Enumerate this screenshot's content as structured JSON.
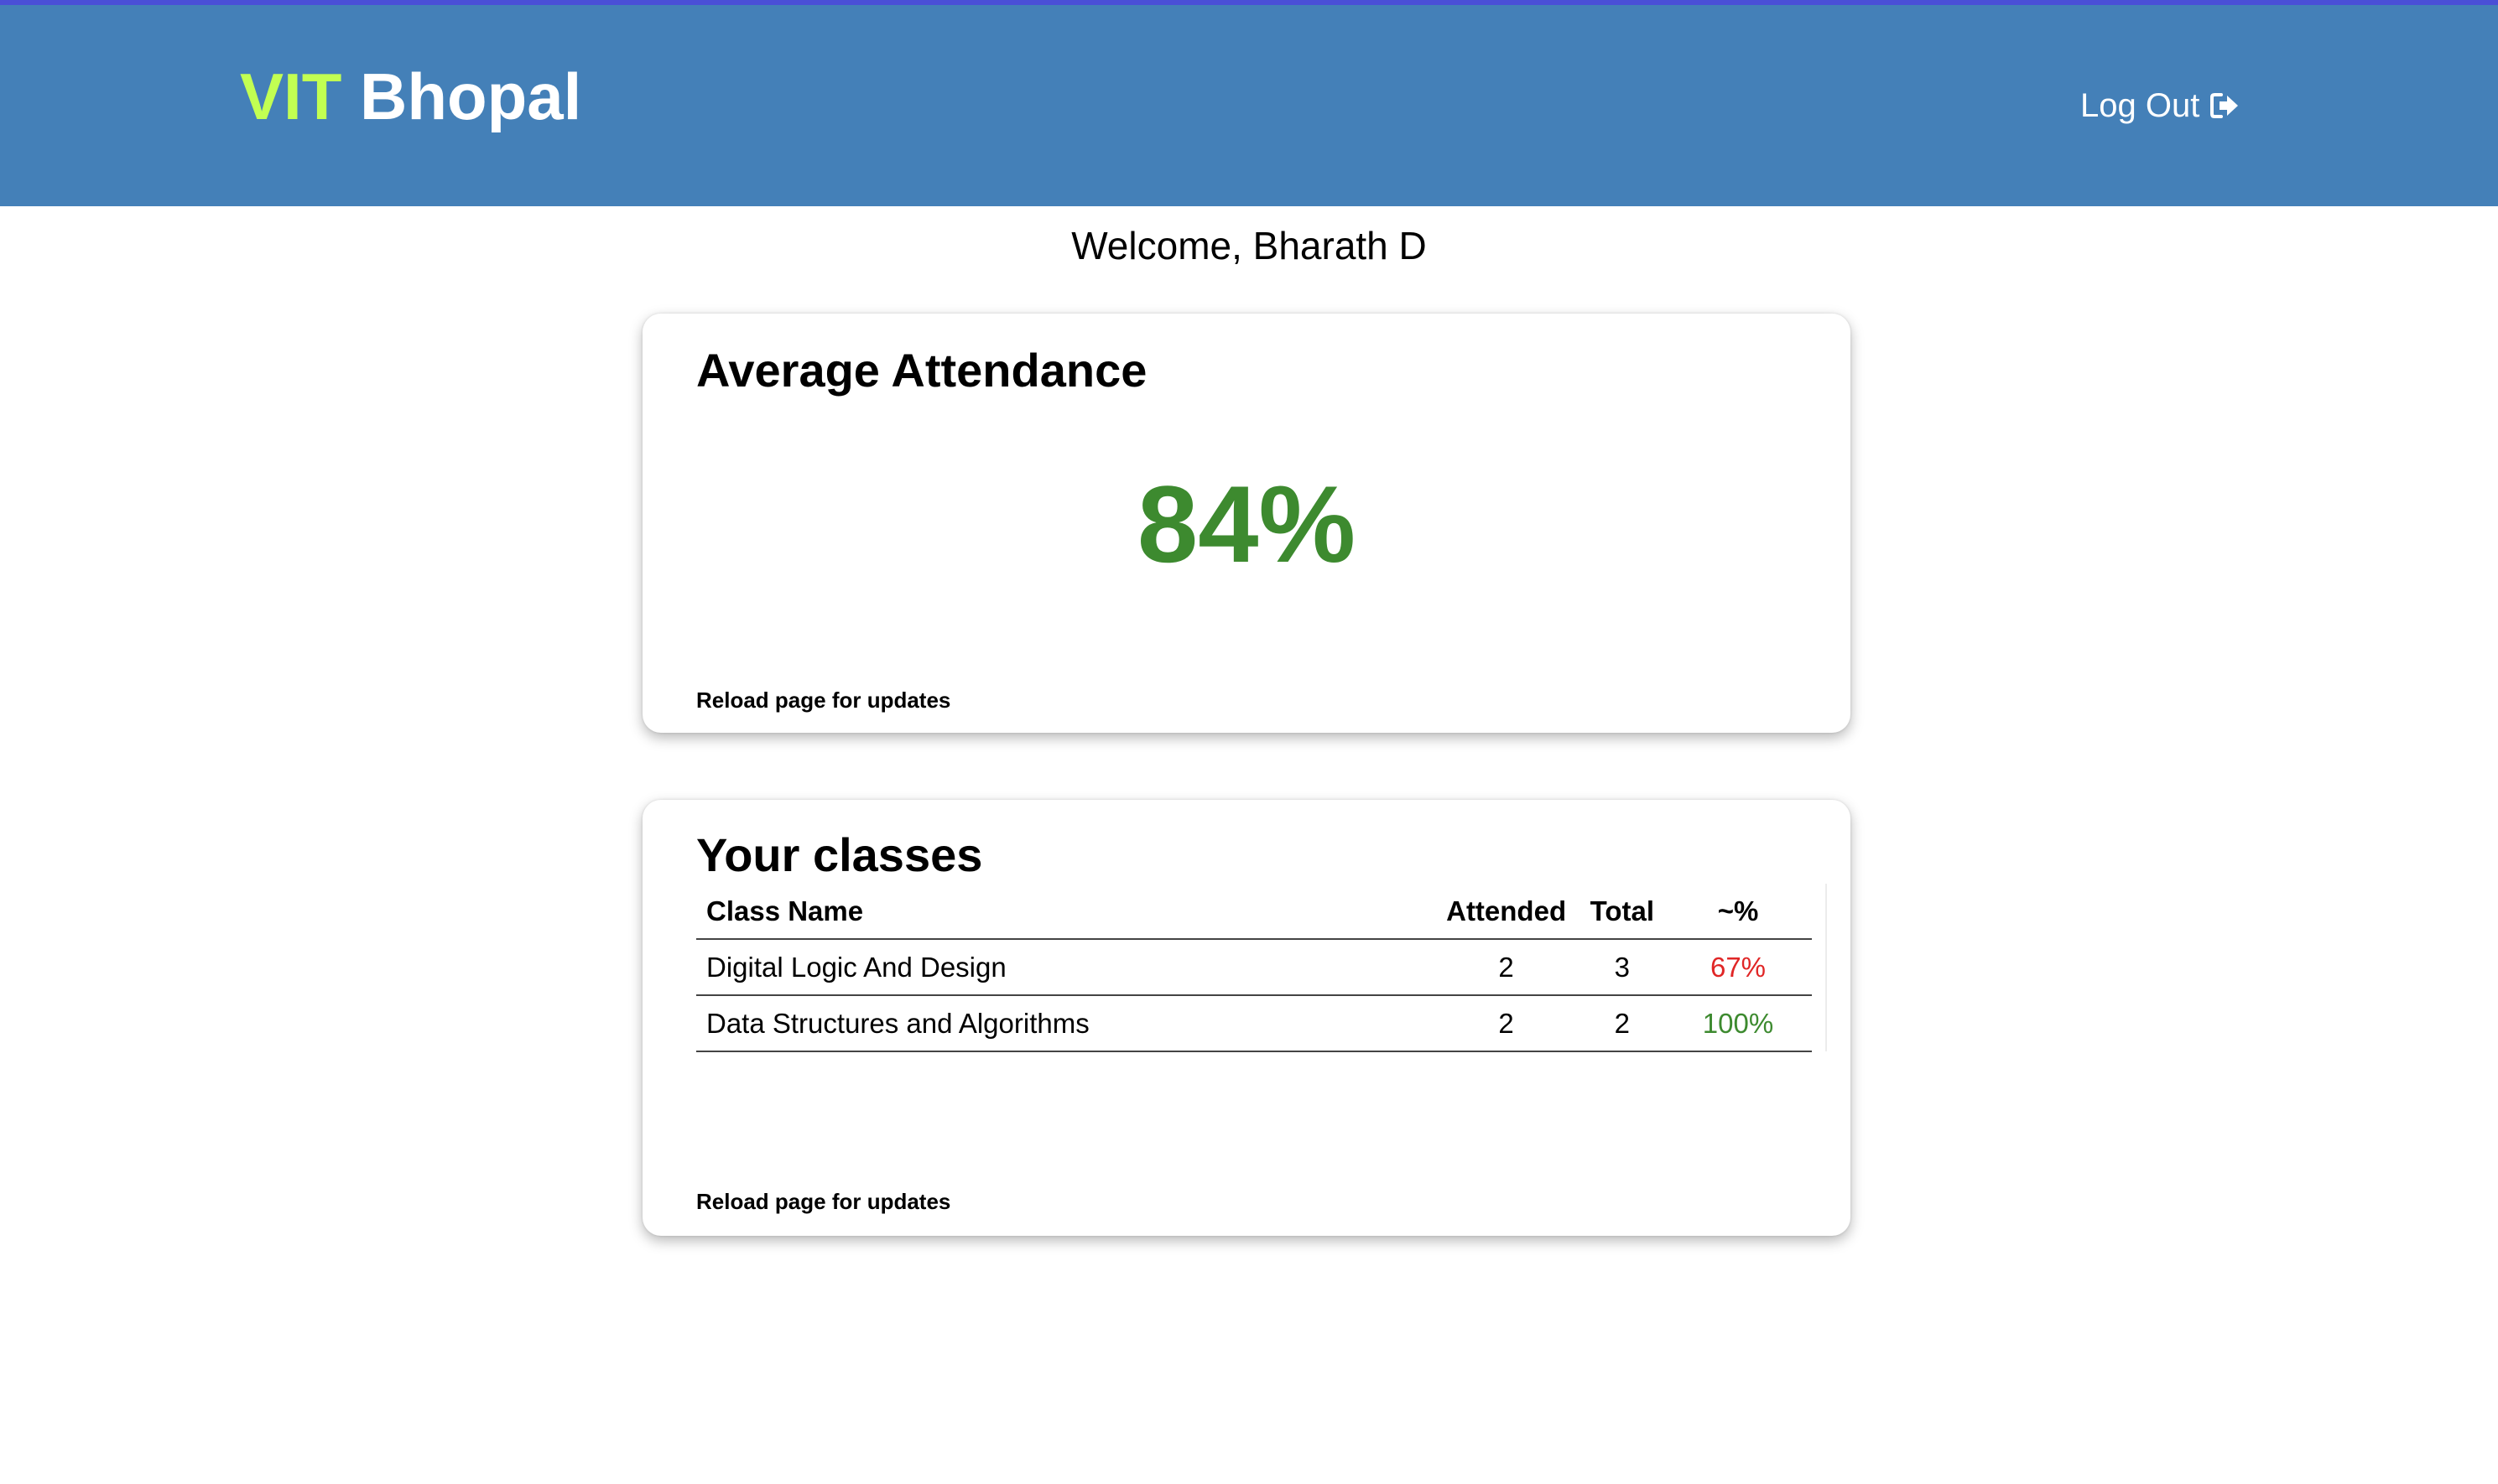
{
  "header": {
    "logo_part1": "VIT",
    "logo_part2": "Bhopal",
    "logout_label": "Log Out"
  },
  "welcome_text": "Welcome, Bharath D",
  "attendance_card": {
    "title": "Average Attendance",
    "percentage": "84%",
    "reload_note": "Reload page for updates"
  },
  "classes_card": {
    "title": "Your classes",
    "columns": [
      "Class Name",
      "Attended",
      "Total",
      "~%"
    ],
    "rows": [
      {
        "name": "Digital Logic And Design",
        "attended": "2",
        "total": "3",
        "percent": "67%",
        "status": "low"
      },
      {
        "name": "Data Structures and Algorithms",
        "attended": "2",
        "total": "2",
        "percent": "100%",
        "status": "good"
      }
    ],
    "reload_note": "Reload page for updates"
  },
  "colors": {
    "header_bg": "#4480b8",
    "accent_green": "#3d8a2f",
    "logo_lime": "#c2ff52",
    "low_red": "#e02626"
  },
  "icons": {
    "logout": "sign-out-icon"
  }
}
